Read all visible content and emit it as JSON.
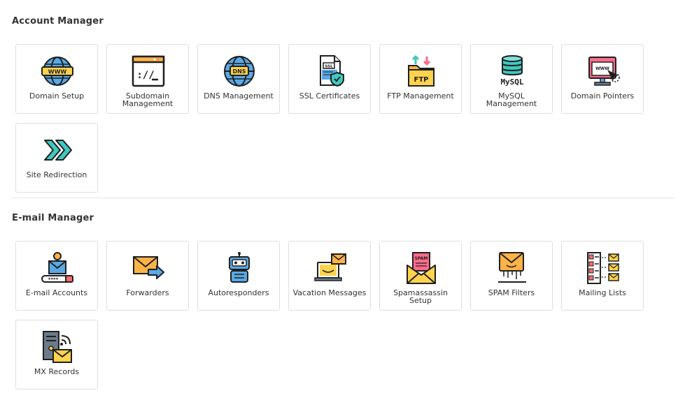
{
  "sections": [
    {
      "title": "Account Manager",
      "tiles": [
        {
          "label": "Domain Setup",
          "icon": "www-globe-icon"
        },
        {
          "label": "Subdomain Management",
          "icon": "terminal-window-icon"
        },
        {
          "label": "DNS Management",
          "icon": "dns-globe-icon"
        },
        {
          "label": "SSL Certificates",
          "icon": "ssl-certificate-icon"
        },
        {
          "label": "FTP Management",
          "icon": "ftp-folder-icon"
        },
        {
          "label": "MySQL Management",
          "icon": "mysql-database-icon"
        },
        {
          "label": "Domain Pointers",
          "icon": "browser-pointer-icon"
        },
        {
          "label": "Site Redirection",
          "icon": "redirect-arrows-icon"
        }
      ]
    },
    {
      "title": "E-mail Manager",
      "tiles": [
        {
          "label": "E-mail Accounts",
          "icon": "email-account-icon"
        },
        {
          "label": "Forwarders",
          "icon": "email-forward-icon"
        },
        {
          "label": "Autoresponders",
          "icon": "robot-icon"
        },
        {
          "label": "Vacation Messages",
          "icon": "vacation-laptop-icon"
        },
        {
          "label": "Spamassassin Setup",
          "icon": "spam-envelope-icon"
        },
        {
          "label": "SPAM Filters",
          "icon": "spam-filter-icon"
        },
        {
          "label": "Mailing Lists",
          "icon": "mailing-list-icon"
        },
        {
          "label": "MX Records",
          "icon": "mx-server-icon"
        }
      ]
    }
  ],
  "colors": {
    "outline": "#1f1f1f",
    "blue": "#5aa9e6",
    "yellow": "#ffd34e",
    "orange": "#ffb347",
    "pink": "#ff6b8a",
    "teal": "#3ec9c0",
    "gray": "#6c7a89"
  }
}
